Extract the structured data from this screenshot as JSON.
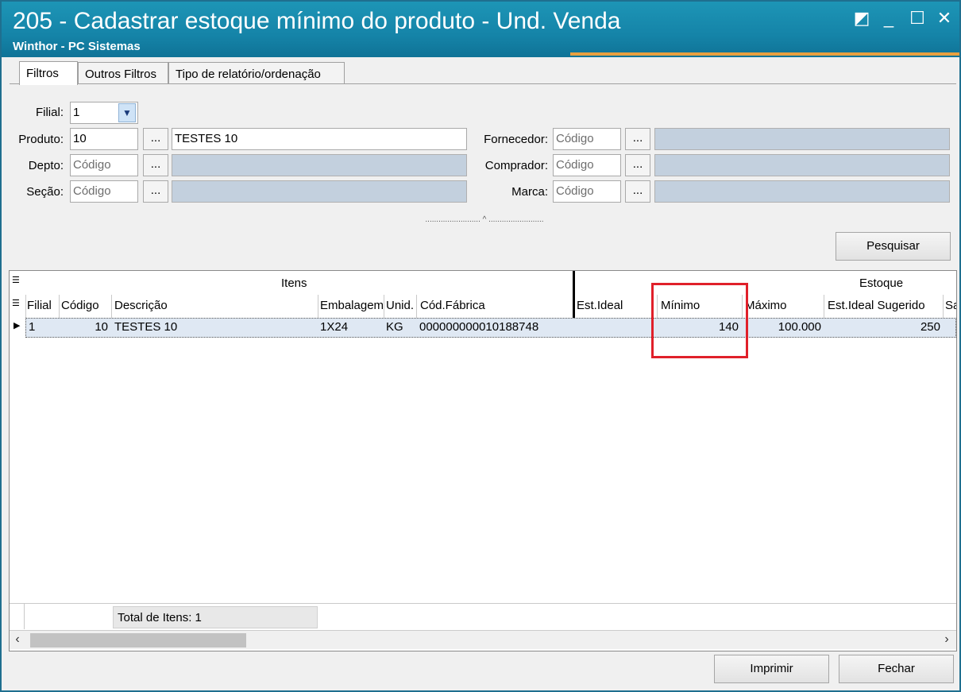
{
  "window": {
    "title": "205 - Cadastrar estoque mínimo do produto - Und. Venda",
    "subtitle": "Winthor - PC Sistemas",
    "restore_icon": "◩",
    "minimize_icon": "_",
    "maximize_icon": "☐",
    "close_icon": "✕"
  },
  "tabs": [
    {
      "label": "Filtros"
    },
    {
      "label": "Outros Filtros"
    },
    {
      "label": "Tipo de relatório/ordenação"
    }
  ],
  "filters": {
    "filial": {
      "label": "Filial:",
      "value": "1"
    },
    "produto": {
      "label": "Produto:",
      "code": "10",
      "description": "TESTES 10"
    },
    "depto": {
      "label": "Depto:",
      "placeholder": "Código"
    },
    "secao": {
      "label": "Seção:",
      "placeholder": "Código"
    },
    "fornecedor": {
      "label": "Fornecedor:",
      "placeholder": "Código"
    },
    "comprador": {
      "label": "Comprador:",
      "placeholder": "Código"
    },
    "marca": {
      "label": "Marca:",
      "placeholder": "Código"
    },
    "dots_label": "...",
    "splitter": ".........................  ^  ........................."
  },
  "buttons": {
    "pesquisar": "Pesquisar",
    "imprimir": "Imprimir",
    "fechar": "Fechar"
  },
  "grid": {
    "group_itens": "Itens",
    "group_estoque": "Estoque",
    "columns": [
      "Filial",
      "Código",
      "Descrição",
      "Embalagem",
      "Unid.",
      "Cód.Fábrica",
      "Est.Ideal",
      "Mínimo",
      "Máximo",
      "Est.Ideal Sugerido",
      "Sa"
    ],
    "rows": [
      {
        "filial": "1",
        "codigo": "10",
        "descricao": "TESTES 10",
        "embalagem": "1X24",
        "unid": "KG",
        "cod_fabrica": "000000000010188748",
        "est_ideal": "",
        "minimo": "140",
        "maximo": "100.000",
        "est_ideal_sugerido": "250"
      }
    ],
    "total_label": "Total de Itens: 1"
  },
  "colors": {
    "titlebar": "#1584a8",
    "highlight": "#e0202a"
  }
}
